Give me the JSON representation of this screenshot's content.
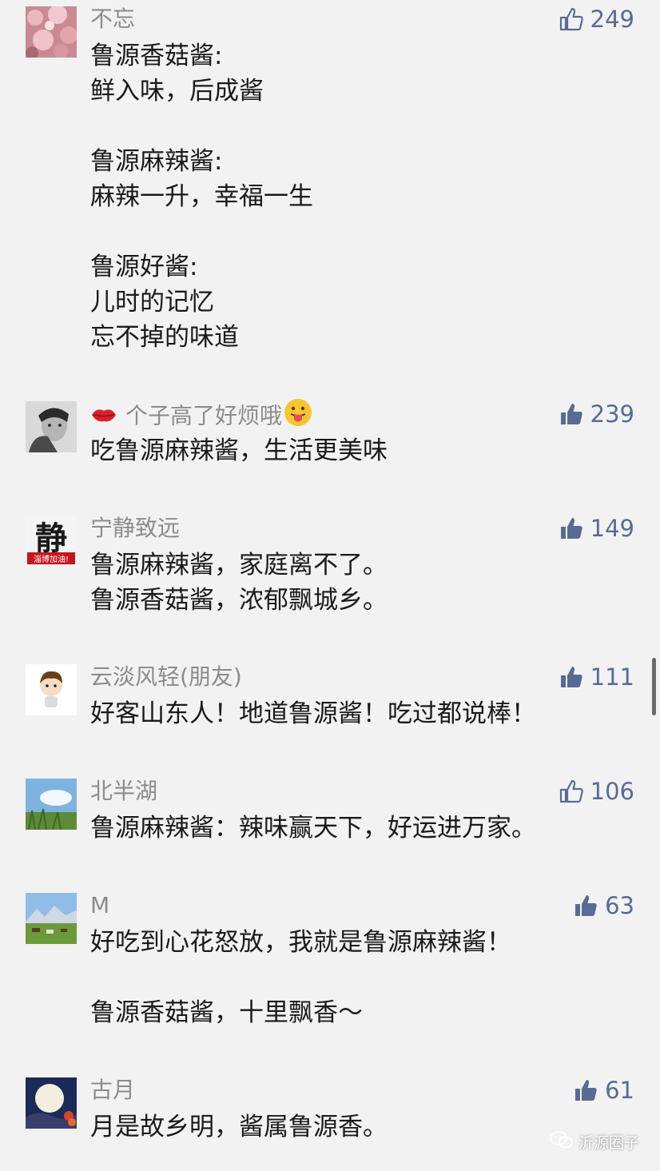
{
  "comments": [
    {
      "name": "不忘",
      "likes": "249",
      "lines": [
        "鲁源香菇酱:",
        "鲜入味，后成酱",
        "",
        "鲁源麻辣酱:",
        "麻辣一升，幸福一生",
        "",
        "鲁源好酱:",
        "儿时的记忆",
        "忘不掉的味道"
      ]
    },
    {
      "name": "个子高了好烦哦",
      "likes": "239",
      "lines": [
        "吃鲁源麻辣酱，生活更美味"
      ]
    },
    {
      "name": "宁静致远",
      "likes": "149",
      "avatar_text": "静",
      "avatar_banner": "淄博加油!",
      "lines": [
        "鲁源麻辣酱，家庭离不了。",
        "鲁源香菇酱，浓郁飘城乡。"
      ]
    },
    {
      "name": "云淡风轻(朋友)",
      "likes": "111",
      "lines": [
        "好客山东人！地道鲁源酱！吃过都说棒！"
      ]
    },
    {
      "name": "北半湖",
      "likes": "106",
      "lines": [
        "鲁源麻辣酱：辣味赢天下，好运进万家。"
      ]
    },
    {
      "name": "M",
      "likes": "63",
      "lines": [
        "好吃到心花怒放，我就是鲁源麻辣酱！",
        "",
        "鲁源香菇酱，十里飘香～"
      ]
    },
    {
      "name": "古月",
      "likes": "61",
      "lines": [
        "月是故乡明，酱属鲁源香。"
      ]
    }
  ],
  "watermark": "沂源圈子",
  "colors": {
    "background": "#f2f2f2",
    "name": "#8c8c8c",
    "like": "#576b95",
    "text": "#1a1a1a"
  }
}
